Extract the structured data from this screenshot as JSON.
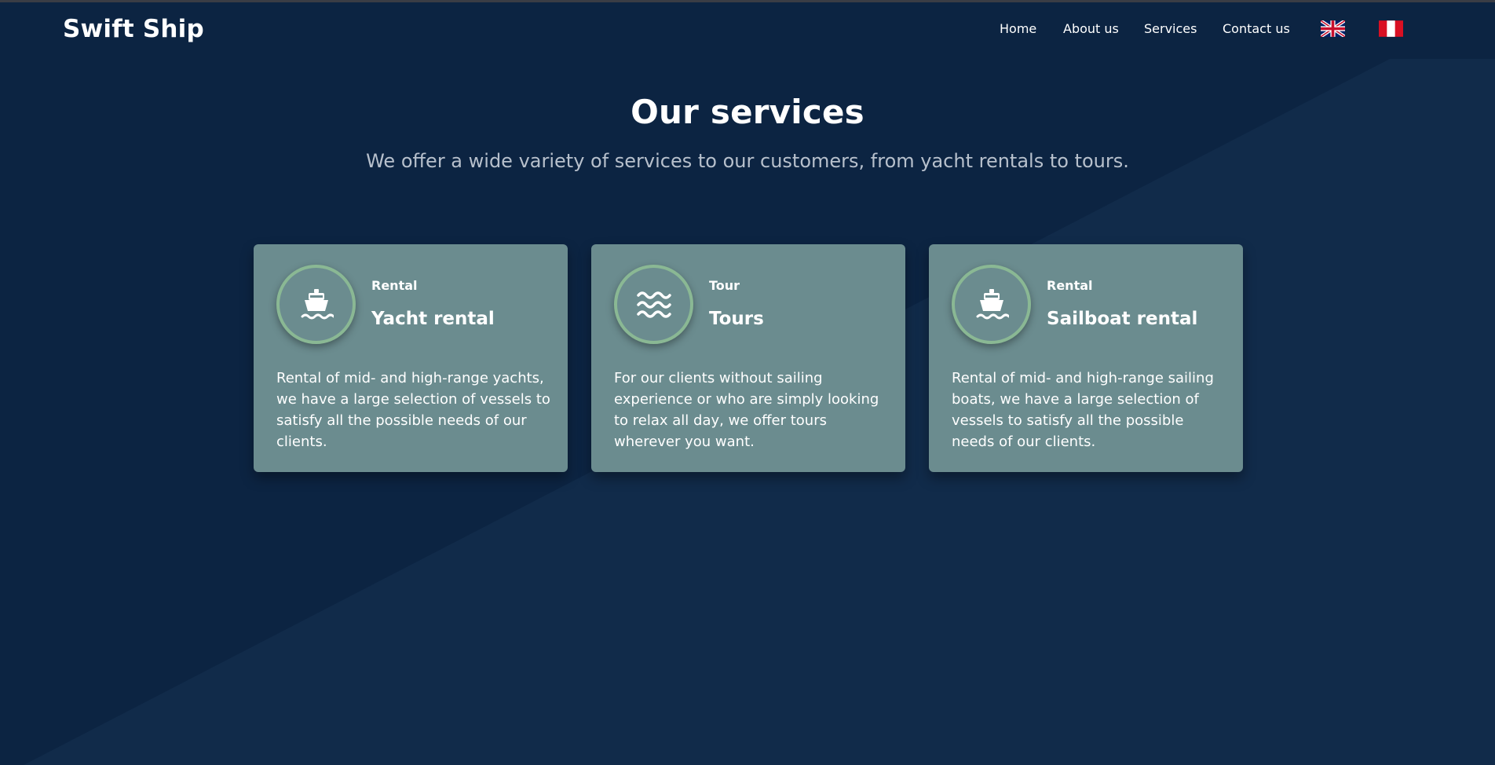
{
  "navbar": {
    "brand": "Swift Ship",
    "links": [
      "Home",
      "About us",
      "Services",
      "Contact us"
    ],
    "flags": [
      {
        "name": "uk-flag-icon"
      },
      {
        "name": "peru-flag-icon"
      }
    ]
  },
  "hero": {
    "title": "Our services",
    "subtitle": "We offer a wide variety of services to our customers, from yacht rentals to tours."
  },
  "cards": [
    {
      "category": "Rental",
      "title": "Yacht rental",
      "icon": "ship-icon",
      "description": "Rental of mid- and high-range yachts, we have a large selection of vessels to satisfy all the possible needs of our clients."
    },
    {
      "category": "Tour",
      "title": "Tours",
      "icon": "water-waves-icon",
      "description": "For our clients without sailing experience or who are simply looking to relax all day, we offer tours wherever you want."
    },
    {
      "category": "Rental",
      "title": "Sailboat rental",
      "icon": "ship-icon",
      "description": "Rental of mid- and high-range sailing boats, we have a large selection of vessels to satisfy all the possible needs of our clients."
    }
  ],
  "colors": {
    "background": "#0c2442",
    "card": "#6b8c8f",
    "icon_border": "#8ab894",
    "subtitle": "#b7c0cc"
  }
}
